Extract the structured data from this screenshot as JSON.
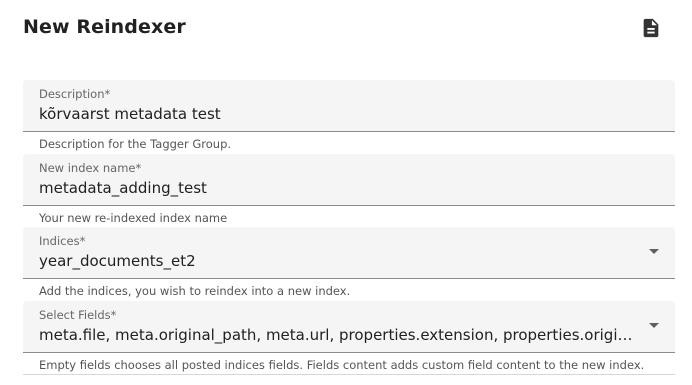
{
  "header": {
    "title": "New Reindexer",
    "doc_icon": "document-icon"
  },
  "form": {
    "description": {
      "label": "Description*",
      "value": "kõrvaarst metadata test",
      "hint": "Description for the Tagger Group."
    },
    "new_index_name": {
      "label": "New index name*",
      "value": "metadata_adding_test",
      "hint": "Your new re-indexed index name"
    },
    "indices": {
      "label": "Indices*",
      "value": "year_documents_et2",
      "hint": "Add the indices, you wish to reindex into a new index."
    },
    "select_fields": {
      "label": "Select Fields*",
      "value": "meta.file, meta.original_path, meta.url, properties.extension, properties.origin, properties.title",
      "hint": "Empty fields chooses all posted indices fields. Fields content adds custom field content to the new index."
    }
  }
}
